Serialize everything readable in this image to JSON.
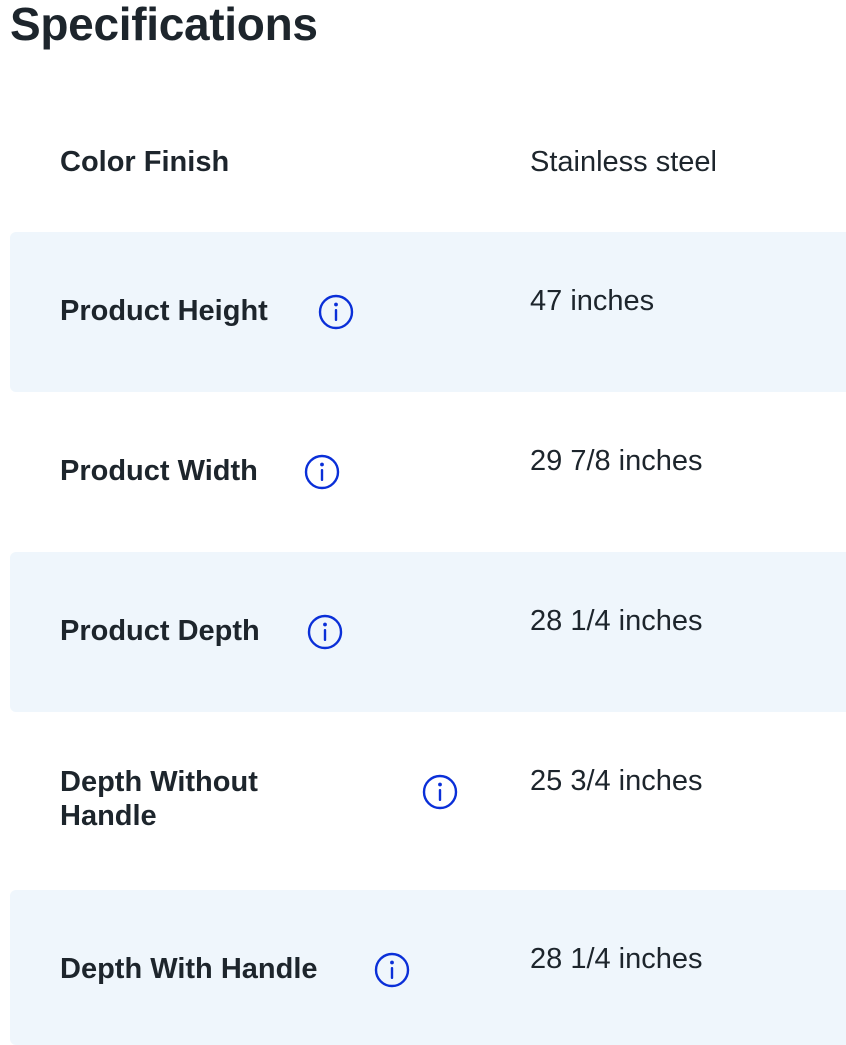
{
  "title": "Specifications",
  "info_icon": {
    "name": "info-icon",
    "color": "#0a2fd8"
  },
  "colors": {
    "row_shade": "#eff6fc",
    "text": "#1d252c"
  },
  "specs": [
    {
      "name": "Color Finish",
      "value": "Stainless steel",
      "has_info": false
    },
    {
      "name": "Product Height",
      "value": "47 inches",
      "has_info": true
    },
    {
      "name": "Product Width",
      "value": "29 7/8 inches",
      "has_info": true
    },
    {
      "name": "Product Depth",
      "value": "28 1/4 inches",
      "has_info": true
    },
    {
      "name": "Depth Without Handle",
      "value": "25 3/4 inches",
      "has_info": true
    },
    {
      "name": "Depth With Handle",
      "value": "28 1/4 inches",
      "has_info": true
    }
  ]
}
